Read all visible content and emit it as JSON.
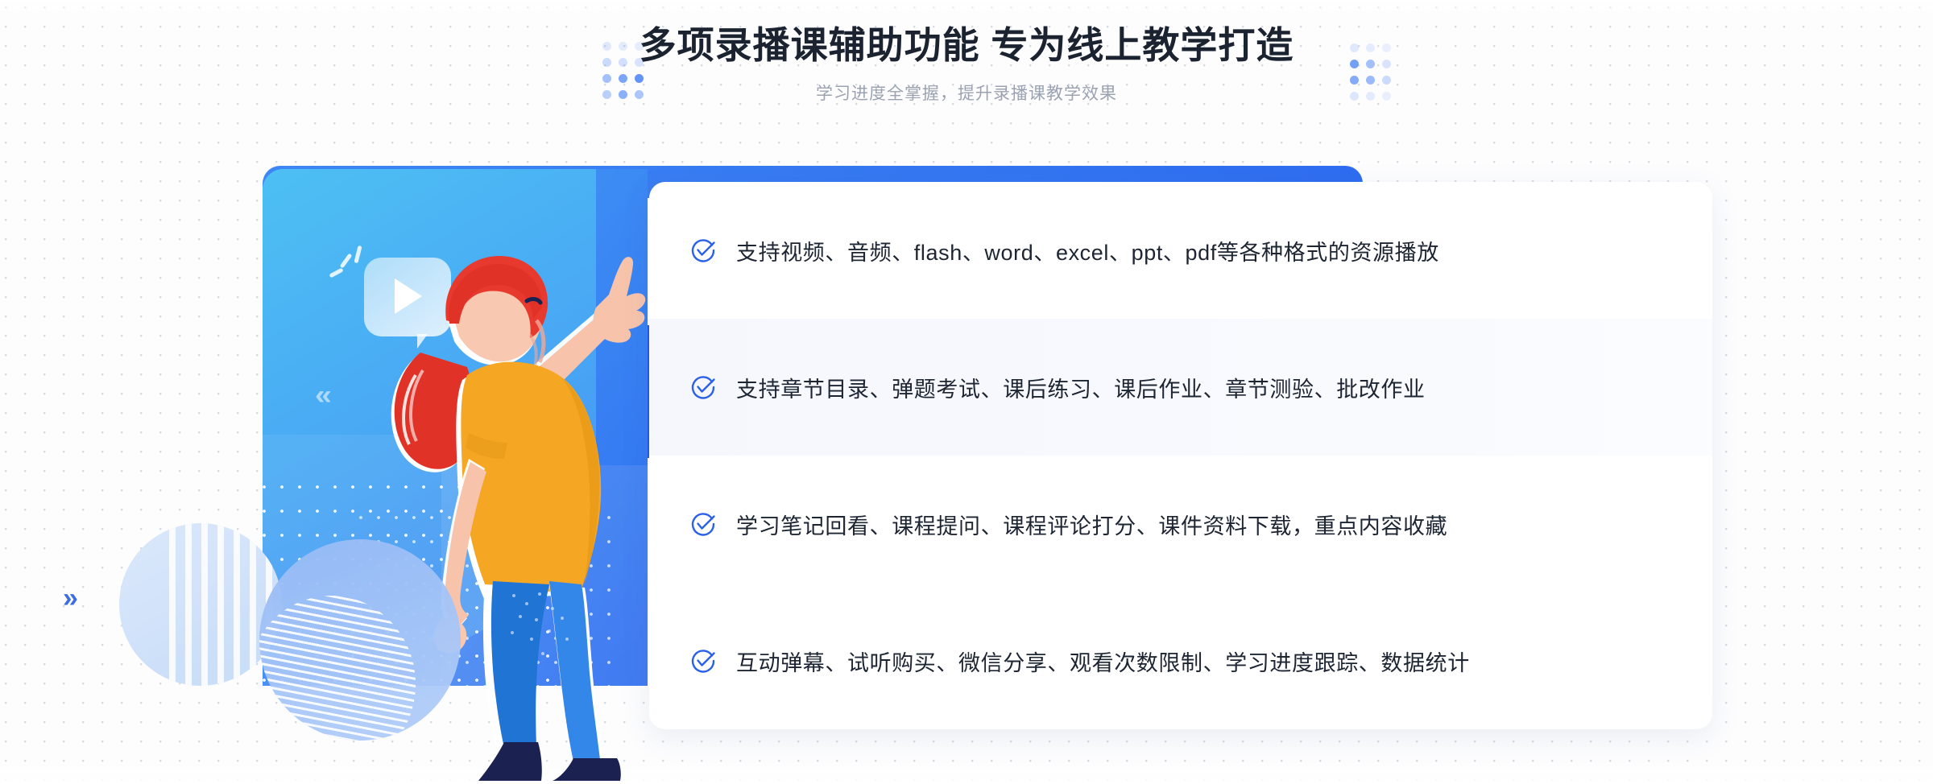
{
  "header": {
    "title": "多项录播课辅助功能 专为线上教学打造",
    "subtitle": "学习进度全掌握，提升录播课教学效果"
  },
  "decorations": {
    "left_dot_cluster": "dot-grid-decoration",
    "right_dot_cluster": "dot-grid-decoration",
    "left_chevron": "»",
    "card_chevron": "«"
  },
  "illustration": {
    "alt": "woman pointing at video play bubble",
    "play_bubble": "play-button-speech-bubble"
  },
  "features": [
    {
      "icon": "check-circle-icon",
      "text": "支持视频、音频、flash、word、excel、ppt、pdf等各种格式的资源播放",
      "highlighted": false
    },
    {
      "icon": "check-circle-icon",
      "text": "支持章节目录、弹题考试、课后练习、课后作业、章节测验、批改作业",
      "highlighted": true
    },
    {
      "icon": "check-circle-icon",
      "text": "学习笔记回看、课程提问、课程评论打分、课件资料下载，重点内容收藏",
      "highlighted": false
    },
    {
      "icon": "check-circle-icon",
      "text": "互动弹幕、试听购买、微信分享、观看次数限制、学习进度跟踪、数据统计",
      "highlighted": false
    }
  ],
  "colors": {
    "accent_blue": "#2f6df0",
    "check_blue": "#2a61e8",
    "title_dark": "#1b2230",
    "subtitle_grey": "#9aa2b1",
    "highlight_row": "#f5f7fd",
    "shirt_yellow": "#f5a623",
    "hair_red": "#e8392f",
    "pants_blue": "#2f7fe0",
    "shoes_navy": "#1b2151"
  }
}
